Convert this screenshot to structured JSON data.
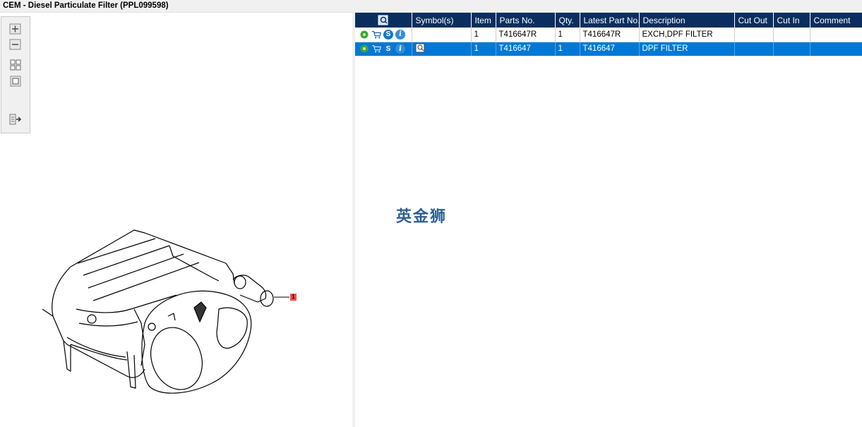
{
  "window": {
    "title": "CEM - Diesel Particulate Filter (PPL099598)"
  },
  "toolbar": {
    "tools": [
      {
        "name": "zoom-in-icon"
      },
      {
        "name": "zoom-out-icon"
      },
      {
        "name": "fit-grid-icon"
      },
      {
        "name": "fit-page-icon"
      },
      {
        "name": "export-list-icon"
      }
    ]
  },
  "diagram": {
    "callout_label": "1"
  },
  "table": {
    "columns": [
      "Symbol(s)",
      "Item",
      "Parts No.",
      "Qty.",
      "Latest Part No.",
      "Description",
      "Cut Out",
      "Cut In",
      "Comment"
    ],
    "rows": [
      {
        "symbols": "",
        "item": "1",
        "part_no": "T416647R",
        "qty": "1",
        "latest_part_no": "T416647R",
        "description": "EXCH,DPF FILTER",
        "cut_out": "",
        "cut_in": "",
        "comment": "",
        "selected": false
      },
      {
        "symbols": "",
        "item": "1",
        "part_no": "T416647",
        "qty": "1",
        "latest_part_no": "T416647",
        "description": "DPF FILTER",
        "cut_out": "",
        "cut_in": "",
        "comment": "",
        "selected": true
      }
    ]
  },
  "watermark": {
    "text": "英金狮"
  },
  "colors": {
    "header_bg": "#0a2f5e",
    "selected_row": "#0078d7",
    "watermark": "#2d5f92",
    "callout": "#ff4d4d"
  }
}
